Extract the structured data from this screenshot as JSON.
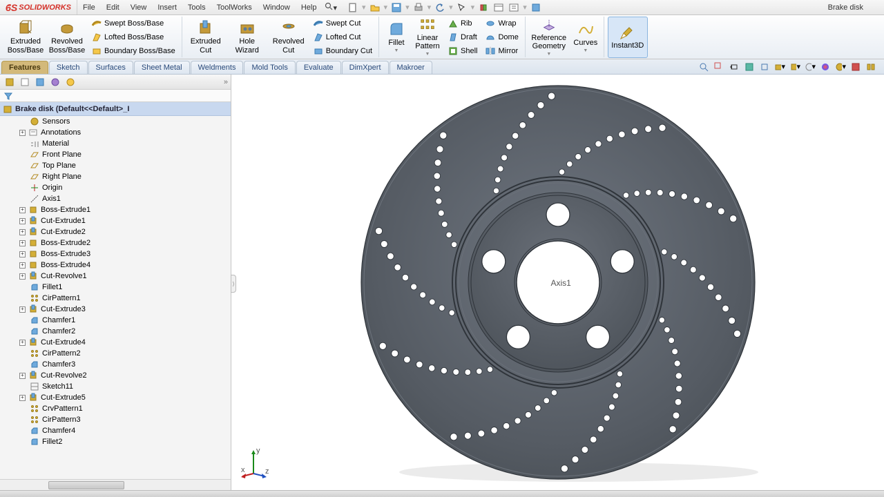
{
  "app": {
    "brand": "SOLIDWORKS",
    "doc_title": "Brake disk"
  },
  "menu": [
    "File",
    "Edit",
    "View",
    "Insert",
    "Tools",
    "ToolWorks",
    "Window",
    "Help"
  ],
  "ribbon": {
    "extruded_boss": "Extruded\nBoss/Base",
    "revolved_boss": "Revolved\nBoss/Base",
    "swept_boss": "Swept Boss/Base",
    "lofted_boss": "Lofted Boss/Base",
    "boundary_boss": "Boundary Boss/Base",
    "extruded_cut": "Extruded\nCut",
    "hole_wizard": "Hole\nWizard",
    "revolved_cut": "Revolved\nCut",
    "swept_cut": "Swept Cut",
    "lofted_cut": "Lofted Cut",
    "boundary_cut": "Boundary Cut",
    "fillet": "Fillet",
    "linear_pattern": "Linear\nPattern",
    "rib": "Rib",
    "draft": "Draft",
    "shell": "Shell",
    "wrap": "Wrap",
    "dome": "Dome",
    "mirror": "Mirror",
    "reference_geometry": "Reference\nGeometry",
    "curves": "Curves",
    "instant3d": "Instant3D"
  },
  "tabs": [
    "Features",
    "Sketch",
    "Surfaces",
    "Sheet Metal",
    "Weldments",
    "Mold Tools",
    "Evaluate",
    "DimXpert",
    "Makroer"
  ],
  "tree": {
    "root": "Brake disk  (Default<<Default>_I",
    "items": [
      {
        "label": "Sensors",
        "icon": "sensor",
        "exp": ""
      },
      {
        "label": "Annotations",
        "icon": "annot",
        "exp": "+"
      },
      {
        "label": "Material <not specified>",
        "icon": "material",
        "exp": ""
      },
      {
        "label": "Front Plane",
        "icon": "plane",
        "exp": ""
      },
      {
        "label": "Top Plane",
        "icon": "plane",
        "exp": ""
      },
      {
        "label": "Right Plane",
        "icon": "plane",
        "exp": ""
      },
      {
        "label": "Origin",
        "icon": "origin",
        "exp": ""
      },
      {
        "label": "Axis1",
        "icon": "axis",
        "exp": ""
      },
      {
        "label": "Boss-Extrude1",
        "icon": "feature",
        "exp": "+"
      },
      {
        "label": "Cut-Extrude1",
        "icon": "cut",
        "exp": "+"
      },
      {
        "label": "Cut-Extrude2",
        "icon": "cut",
        "exp": "+"
      },
      {
        "label": "Boss-Extrude2",
        "icon": "feature",
        "exp": "+"
      },
      {
        "label": "Boss-Extrude3",
        "icon": "feature",
        "exp": "+"
      },
      {
        "label": "Boss-Extrude4",
        "icon": "feature",
        "exp": "+"
      },
      {
        "label": "Cut-Revolve1",
        "icon": "cut",
        "exp": "+"
      },
      {
        "label": "Fillet1",
        "icon": "fillet",
        "exp": ""
      },
      {
        "label": "CirPattern1",
        "icon": "pattern",
        "exp": ""
      },
      {
        "label": "Cut-Extrude3",
        "icon": "cut",
        "exp": "+"
      },
      {
        "label": "Chamfer1",
        "icon": "chamfer",
        "exp": ""
      },
      {
        "label": "Chamfer2",
        "icon": "chamfer",
        "exp": ""
      },
      {
        "label": "Cut-Extrude4",
        "icon": "cut",
        "exp": "+"
      },
      {
        "label": "CirPattern2",
        "icon": "pattern",
        "exp": ""
      },
      {
        "label": "Chamfer3",
        "icon": "chamfer",
        "exp": ""
      },
      {
        "label": "Cut-Revolve2",
        "icon": "cut",
        "exp": "+"
      },
      {
        "label": "Sketch11",
        "icon": "sketch",
        "exp": ""
      },
      {
        "label": "Cut-Extrude5",
        "icon": "cut",
        "exp": "+"
      },
      {
        "label": "CrvPattern1",
        "icon": "pattern",
        "exp": ""
      },
      {
        "label": "CirPattern3",
        "icon": "pattern",
        "exp": ""
      },
      {
        "label": "Chamfer4",
        "icon": "chamfer",
        "exp": ""
      },
      {
        "label": "Fillet2",
        "icon": "fillet",
        "exp": ""
      }
    ]
  },
  "viewport": {
    "axis_label": "Axis1"
  }
}
